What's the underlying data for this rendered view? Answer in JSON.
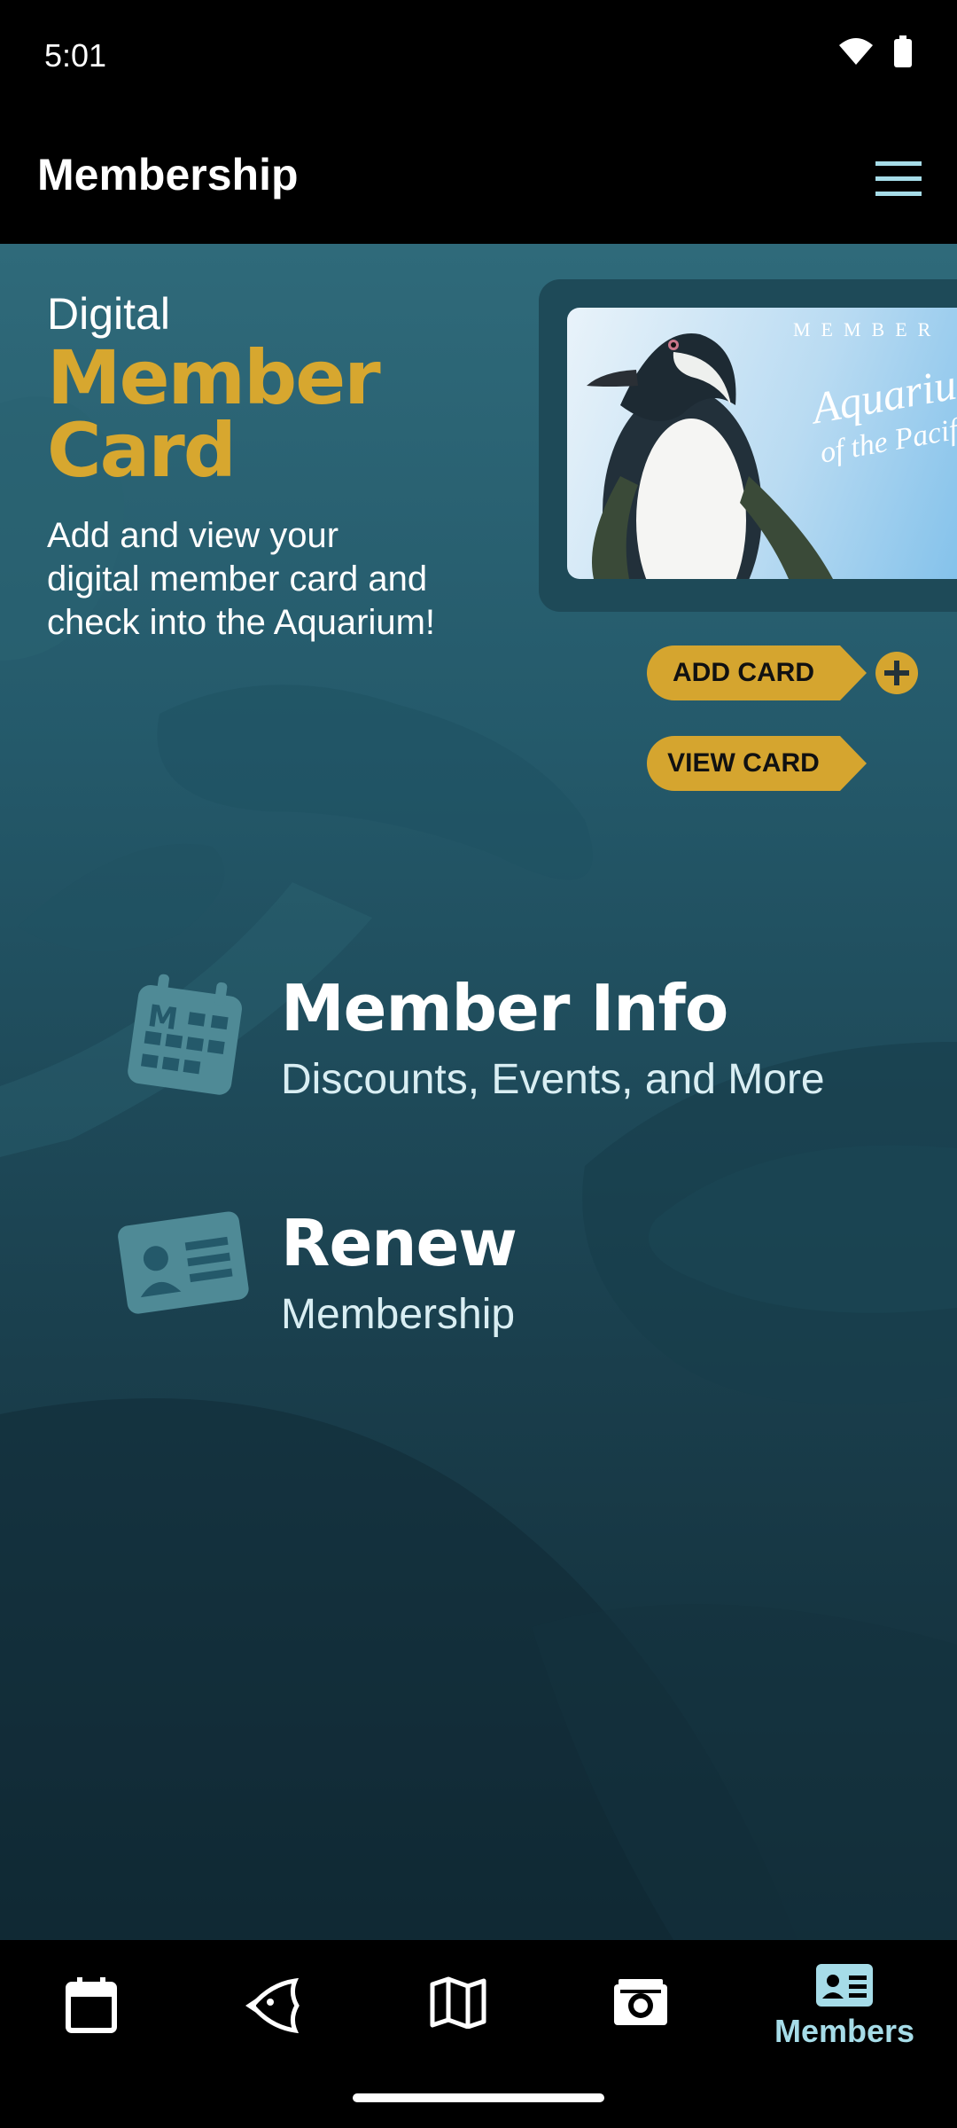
{
  "status_bar": {
    "time": "5:01"
  },
  "app_bar": {
    "title": "Membership"
  },
  "card_section": {
    "kicker": "Digital",
    "headline_line1": "Member",
    "headline_line2": "Card",
    "description": "Add and view your digital member card and check into the Aquarium!",
    "card_label": "MEMBER",
    "card_brand_line1": "Aquarium",
    "card_brand_line2": "of the Pacific",
    "add_card_label": "ADD CARD",
    "view_card_label": "VIEW CARD"
  },
  "links": [
    {
      "title": "Member Info",
      "subtitle": "Discounts, Events, and More"
    },
    {
      "title": "Renew",
      "subtitle": "Membership"
    }
  ],
  "bottom_nav": {
    "items": [
      {
        "icon": "calendar-icon"
      },
      {
        "icon": "fish-icon"
      },
      {
        "icon": "map-icon"
      },
      {
        "icon": "camera-icon"
      },
      {
        "icon": "member-card-icon",
        "label": "Members",
        "active": true
      }
    ]
  },
  "colors": {
    "accent": "#d5a52f",
    "nav_active": "#a6dce8",
    "background": "#24596a"
  }
}
